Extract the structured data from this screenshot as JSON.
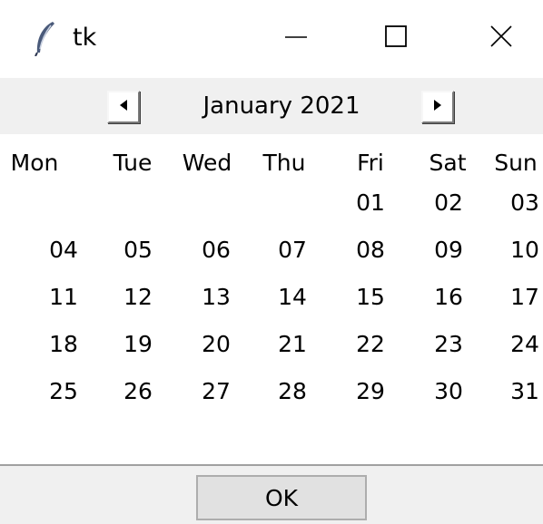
{
  "window": {
    "title": "tk"
  },
  "icons": {
    "app": "feather-icon",
    "minimize": "minimize-icon",
    "maximize": "maximize-icon",
    "close": "close-icon",
    "prev": "triangle-left-icon",
    "next": "triangle-right-icon"
  },
  "calendar": {
    "month_label": "January 2021",
    "weekdays": [
      "Mon",
      "Tue",
      "Wed",
      "Thu",
      "Fri",
      "Sat",
      "Sun"
    ],
    "weeks": [
      [
        "",
        "",
        "",
        "",
        "01",
        "02",
        "03"
      ],
      [
        "04",
        "05",
        "06",
        "07",
        "08",
        "09",
        "10"
      ],
      [
        "11",
        "12",
        "13",
        "14",
        "15",
        "16",
        "17"
      ],
      [
        "18",
        "19",
        "20",
        "21",
        "22",
        "23",
        "24"
      ],
      [
        "25",
        "26",
        "27",
        "28",
        "29",
        "30",
        "31"
      ]
    ]
  },
  "footer": {
    "ok_label": "OK"
  },
  "colors": {
    "nav_background": "#f0f0f0",
    "button_face": "#e1e1e1",
    "button_border": "#adadad",
    "text": "#000000"
  }
}
